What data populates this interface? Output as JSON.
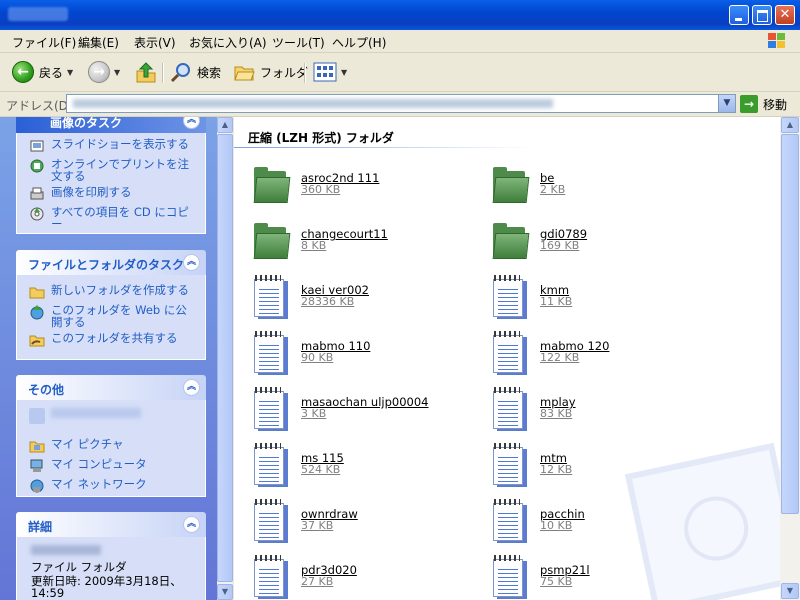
{
  "window": {
    "title": ""
  },
  "menu": [
    "ファイル(F)",
    "編集(E)",
    "表示(V)",
    "お気に入り(A)",
    "ツール(T)",
    "ヘルプ(H)"
  ],
  "toolbar": {
    "back": "戻る",
    "search": "検索",
    "folders": "フォルダ"
  },
  "address": {
    "label": "アドレス(D)",
    "value": "",
    "go": "移動"
  },
  "panels": {
    "image_tasks": {
      "title": "画像のタスク",
      "items": [
        "スライドショーを表示する",
        "オンラインでプリントを注文する",
        "画像を印刷する",
        "すべての項目を CD にコピー"
      ]
    },
    "file_tasks": {
      "title": "ファイルとフォルダのタスク",
      "items": [
        "新しいフォルダを作成する",
        "このフォルダを Web に公開する",
        "このフォルダを共有する"
      ]
    },
    "other": {
      "title": "その他",
      "items": [
        "",
        "マイ ピクチャ",
        "マイ コンピュータ",
        "マイ ネットワーク"
      ]
    },
    "details": {
      "title": "詳細",
      "name": "",
      "type": "ファイル フォルダ",
      "modified": "更新日時: 2009年3月18日、14:59"
    }
  },
  "group_title": "圧縮 (LZH 形式) フォルダ",
  "files": [
    {
      "name": "asroc2nd 111",
      "size": "360 KB",
      "icon": "zip-folder-icon"
    },
    {
      "name": "be",
      "size": "2 KB",
      "icon": "zip-folder-icon"
    },
    {
      "name": "changecourt11",
      "size": "8 KB",
      "icon": "zip-folder-icon"
    },
    {
      "name": "gdi0789",
      "size": "169 KB",
      "icon": "zip-folder-icon"
    },
    {
      "name": "kaei ver002",
      "size": "28336 KB",
      "icon": "notepad-icon"
    },
    {
      "name": "kmm",
      "size": "11 KB",
      "icon": "notepad-icon"
    },
    {
      "name": "mabmo 110",
      "size": "90 KB",
      "icon": "notepad-icon"
    },
    {
      "name": "mabmo 120",
      "size": "122 KB",
      "icon": "notepad-icon"
    },
    {
      "name": "masaochan uljp00004",
      "size": "3 KB",
      "icon": "notepad-icon"
    },
    {
      "name": "mplay",
      "size": "83 KB",
      "icon": "notepad-icon"
    },
    {
      "name": "ms 115",
      "size": "524 KB",
      "icon": "notepad-icon"
    },
    {
      "name": "mtm",
      "size": "12 KB",
      "icon": "notepad-icon"
    },
    {
      "name": "ownrdraw",
      "size": "37 KB",
      "icon": "notepad-icon"
    },
    {
      "name": "pacchin",
      "size": "10 KB",
      "icon": "notepad-icon"
    },
    {
      "name": "pdr3d020",
      "size": "27 KB",
      "icon": "notepad-icon"
    },
    {
      "name": "psmp21l",
      "size": "75 KB",
      "icon": "notepad-icon"
    }
  ]
}
